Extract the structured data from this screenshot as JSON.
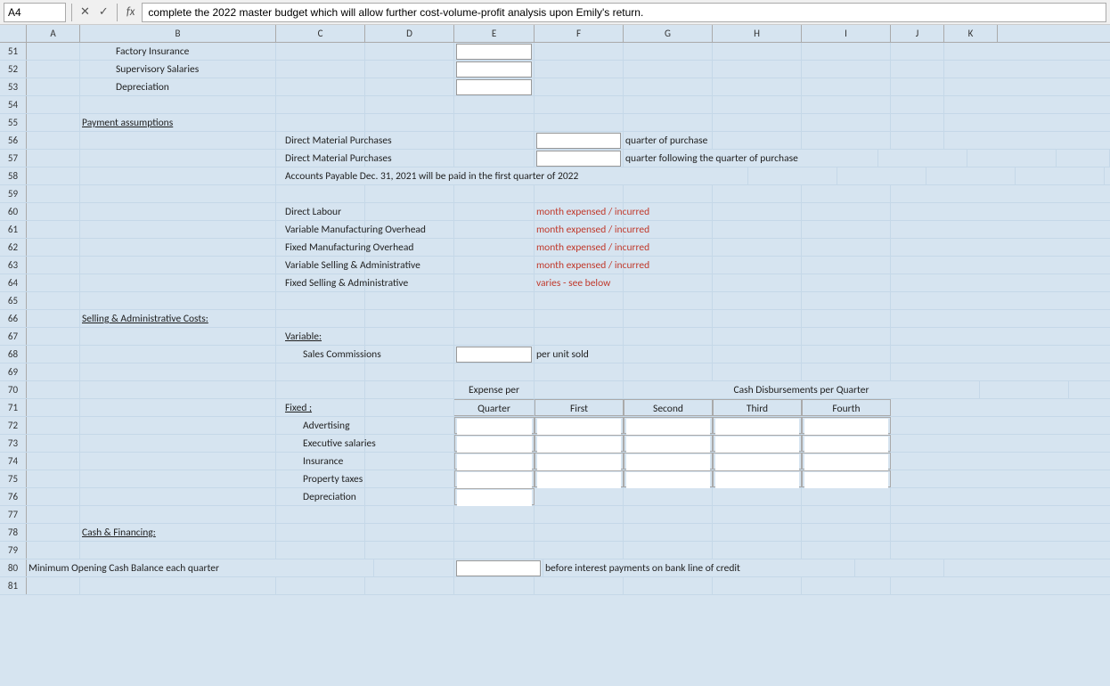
{
  "formulaBar": {
    "cellRef": "A4",
    "formula": "complete the 2022 master budget which will allow further cost-volume-profit analysis upon Emily's return."
  },
  "columns": [
    "A",
    "B",
    "C",
    "D",
    "E",
    "F",
    "G",
    "H",
    "I",
    "J",
    "K"
  ],
  "rows": {
    "51": {
      "c": "Factory Insurance",
      "e_input": true
    },
    "52": {
      "c": "Supervisory Salaries",
      "e_input": true
    },
    "53": {
      "c": "Depreciation",
      "e_input": true
    },
    "54": {},
    "55": {
      "b": "Payment assumptions",
      "b_underline": true
    },
    "56": {
      "c": "Direct Material Purchases",
      "f_input": true,
      "g": "quarter of purchase"
    },
    "57": {
      "c": "Direct Material Purchases",
      "f_input": true,
      "g": "quarter following the quarter of purchase"
    },
    "58": {
      "c": "Accounts Payable Dec. 31, 2021 will be paid in the first quarter of 2022",
      "c_colspan": true
    },
    "59": {},
    "60": {
      "c": "Direct Labour",
      "f": "month expensed / incurred"
    },
    "61": {
      "c": "Variable Manufacturing Overhead",
      "f": "month expensed / incurred"
    },
    "62": {
      "c": "Fixed Manufacturing Overhead",
      "f": "month expensed / incurred"
    },
    "63": {
      "c": "Variable Selling & Administrative",
      "f": "month expensed / incurred"
    },
    "64": {
      "c": "Fixed Selling & Administrative",
      "f": "varies - see below"
    },
    "65": {},
    "66": {
      "b": "Selling & Administrative Costs:",
      "b_underline": true
    },
    "67": {
      "c": "Variable:",
      "c_underline": true
    },
    "68": {
      "c": "Sales Commissions",
      "e_input": true,
      "f": "per unit sold"
    },
    "69": {},
    "70": {
      "e": "Expense per",
      "g": "Cash Disbursements per Quarter",
      "g_colspan": true
    },
    "71": {
      "c": "Fixed :",
      "c_underline": true,
      "e": "Quarter",
      "f": "First",
      "g": "Second",
      "h": "Third",
      "i": "Fourth",
      "show_headers": true
    },
    "72": {
      "c": "Advertising",
      "e_input": true,
      "f_input": true,
      "g_input": true,
      "h_input": true,
      "i_input": true
    },
    "73": {
      "c": "Executive salaries",
      "e_input": true,
      "f_input": true,
      "g_input": true,
      "h_input": true,
      "i_input": true
    },
    "74": {
      "c": "Insurance",
      "e_input": true,
      "f_input": true,
      "g_input": true,
      "h_input": true,
      "i_input": true
    },
    "75": {
      "c": "Property taxes",
      "e_input": true,
      "f_input": true,
      "g_input": true,
      "h_input": true,
      "i_input": true
    },
    "76": {
      "c": "Depreciation",
      "e_input": true
    },
    "77": {},
    "78": {
      "b": "Cash & Financing:",
      "b_underline": true
    },
    "79": {},
    "80": {
      "b": "Minimum Opening Cash Balance each quarter",
      "b_wide": true,
      "f_input": true,
      "g": "before interest payments on bank line of credit"
    },
    "81": {}
  }
}
